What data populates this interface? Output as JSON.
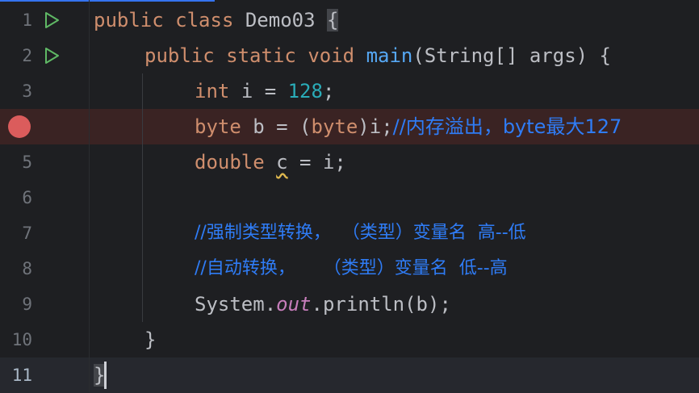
{
  "colors": {
    "background": "#1e1f22",
    "keyword": "#cf8e6d",
    "function": "#56a8f5",
    "number": "#2aacb8",
    "comment": "#2f7cf6",
    "field": "#c77dbb",
    "text": "#bcbec4",
    "breakpoint": "#db5c5c",
    "run_icon": "#5fb865"
  },
  "lines": [
    {
      "no": "1",
      "gutter_icon": "run-icon"
    },
    {
      "no": "2",
      "gutter_icon": "run-icon"
    },
    {
      "no": "3"
    },
    {
      "no": "4",
      "gutter_icon": "breakpoint-icon"
    },
    {
      "no": "5"
    },
    {
      "no": "6"
    },
    {
      "no": "7"
    },
    {
      "no": "8"
    },
    {
      "no": "9"
    },
    {
      "no": "10"
    },
    {
      "no": "11"
    }
  ],
  "code": {
    "l1": {
      "kw1": "public",
      "kw2": "class",
      "name": "Demo03",
      "brace": "{"
    },
    "l2": {
      "kw1": "public",
      "kw2": "static",
      "kw3": "void",
      "fn": "main",
      "rest": "(String[] args) {"
    },
    "l3": {
      "kw": "int",
      "mid": "i = ",
      "num": "128",
      "end": ";"
    },
    "l4": {
      "kw": "byte",
      "mid1": "b = (",
      "kw2": "byte",
      "mid2": ")i;",
      "comment": "//内存溢出，byte最大127"
    },
    "l5": {
      "kw": "double",
      "var": "c",
      "rest": " = i;"
    },
    "l7": {
      "comment": "//强制类型转换，  （类型）变量名  高--低"
    },
    "l8": {
      "comment": "//自动转换，     （类型）变量名  低--高"
    },
    "l9": {
      "pre": "System.",
      "field": "out",
      "post": ".println(b);"
    },
    "l10": {
      "brace": "}"
    },
    "l11": {
      "brace": "}"
    }
  }
}
